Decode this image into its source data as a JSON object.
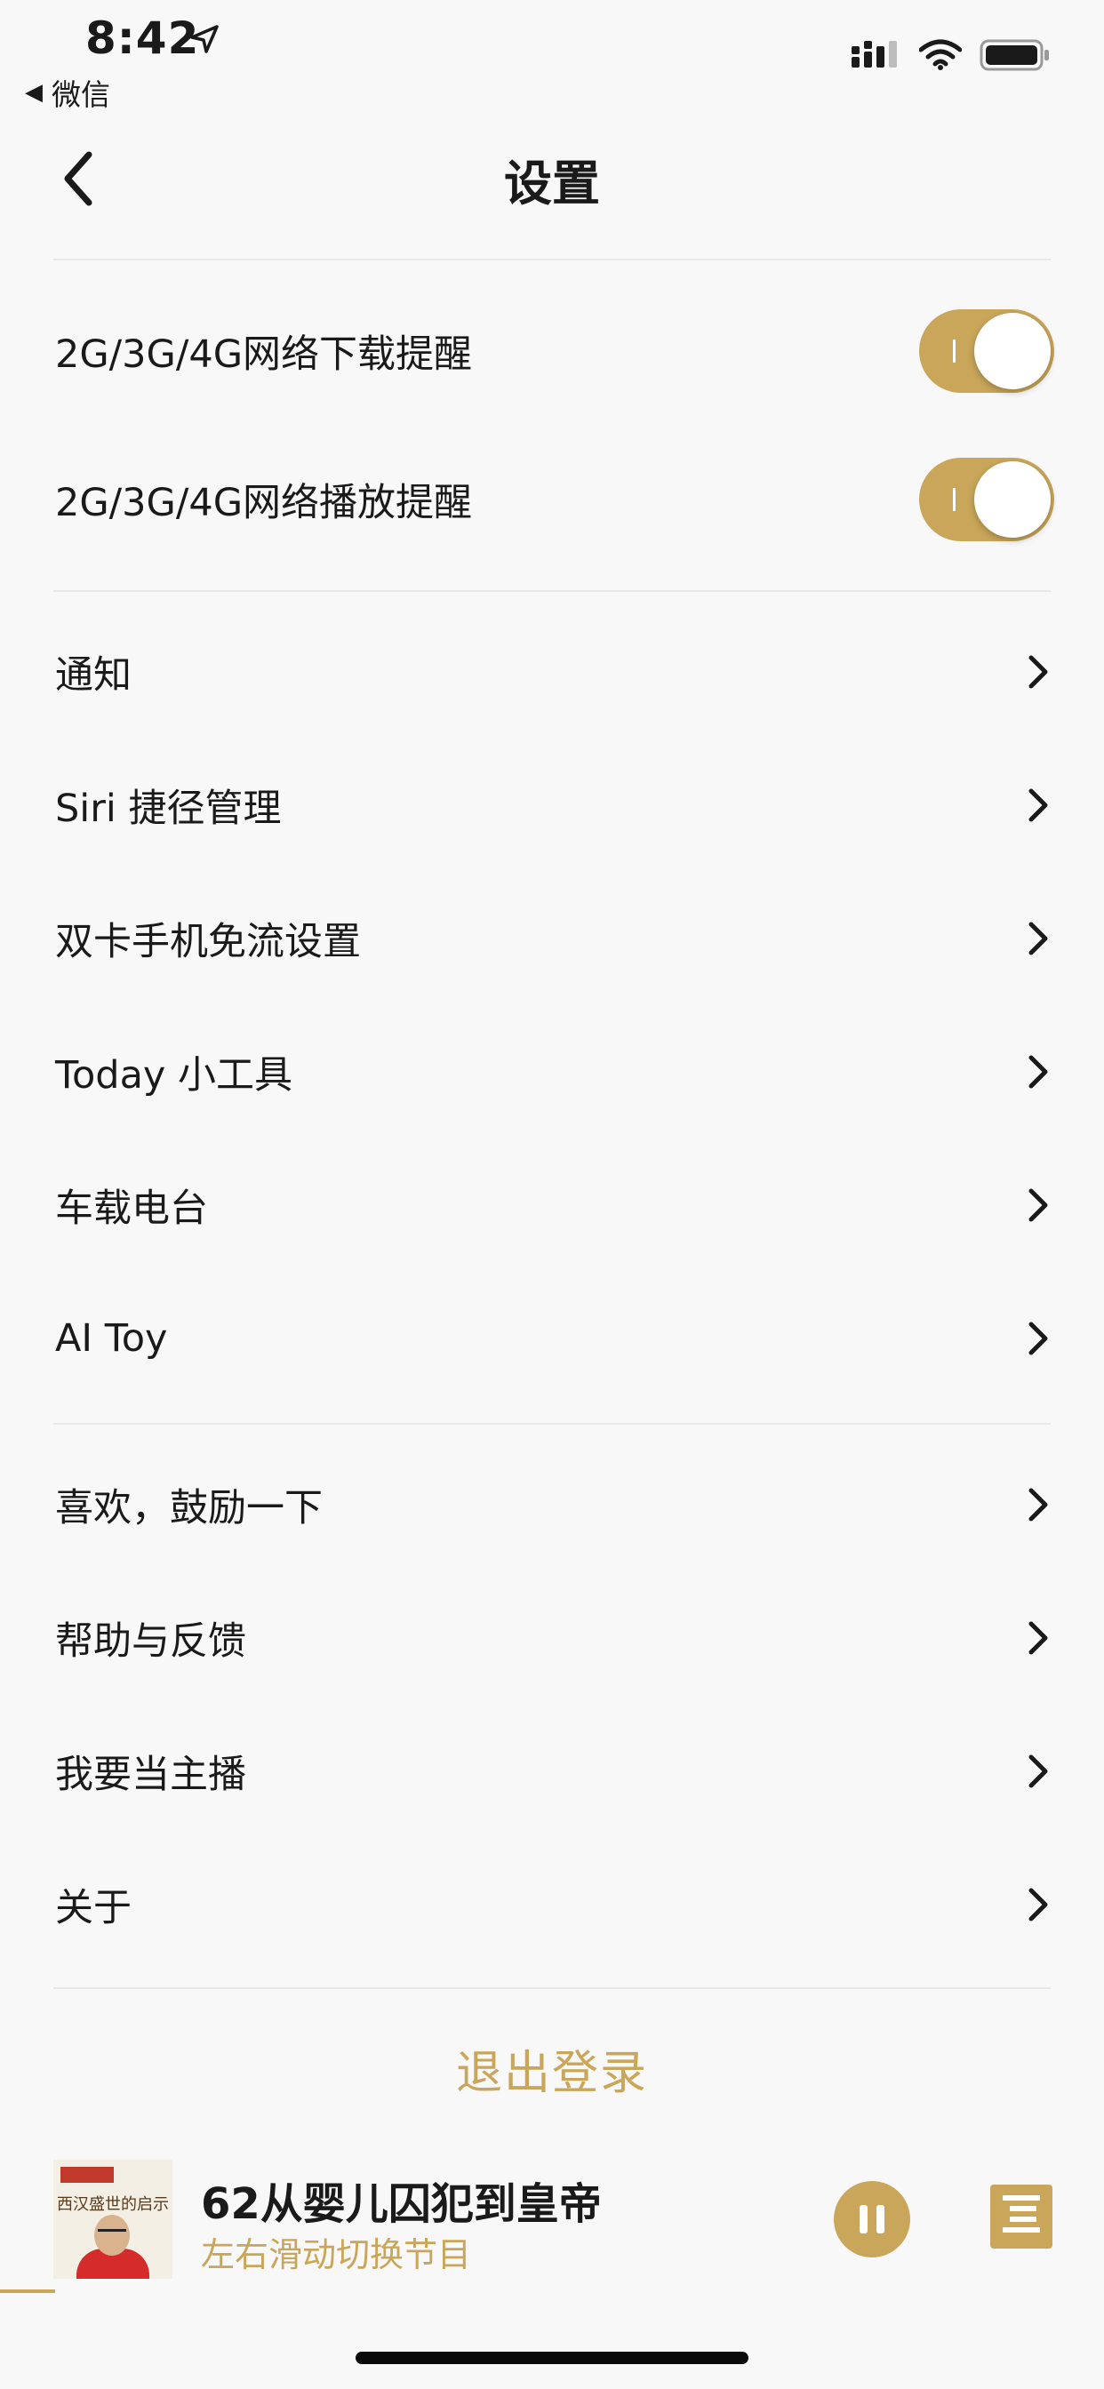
{
  "status_bar": {
    "time": "8:42",
    "back_app_label": "微信"
  },
  "nav": {
    "title": "设置"
  },
  "toggles": [
    {
      "label": "2G/3G/4G网络下载提醒",
      "on": true
    },
    {
      "label": "2G/3G/4G网络播放提醒",
      "on": true
    }
  ],
  "menu_group_1": [
    {
      "label": "通知"
    },
    {
      "label": "Siri 捷径管理"
    },
    {
      "label": "双卡手机免流设置"
    },
    {
      "label": "Today 小工具"
    },
    {
      "label": "车载电台"
    },
    {
      "label": "AI Toy"
    }
  ],
  "menu_group_2": [
    {
      "label": "喜欢，鼓励一下"
    },
    {
      "label": "帮助与反馈"
    },
    {
      "label": "我要当主播"
    },
    {
      "label": "关于"
    }
  ],
  "logout_label": "退出登录",
  "player": {
    "cover_caption": "西汉盛世的启示",
    "track_title": "62从婴儿囚犯到皇帝",
    "hint": "左右滑动切换节目",
    "progress_fraction": 0.05
  },
  "colors": {
    "accent": "#c9a65a",
    "background": "#f8f8f8",
    "text": "#1a1a1a",
    "divider": "#e8e8e8"
  }
}
